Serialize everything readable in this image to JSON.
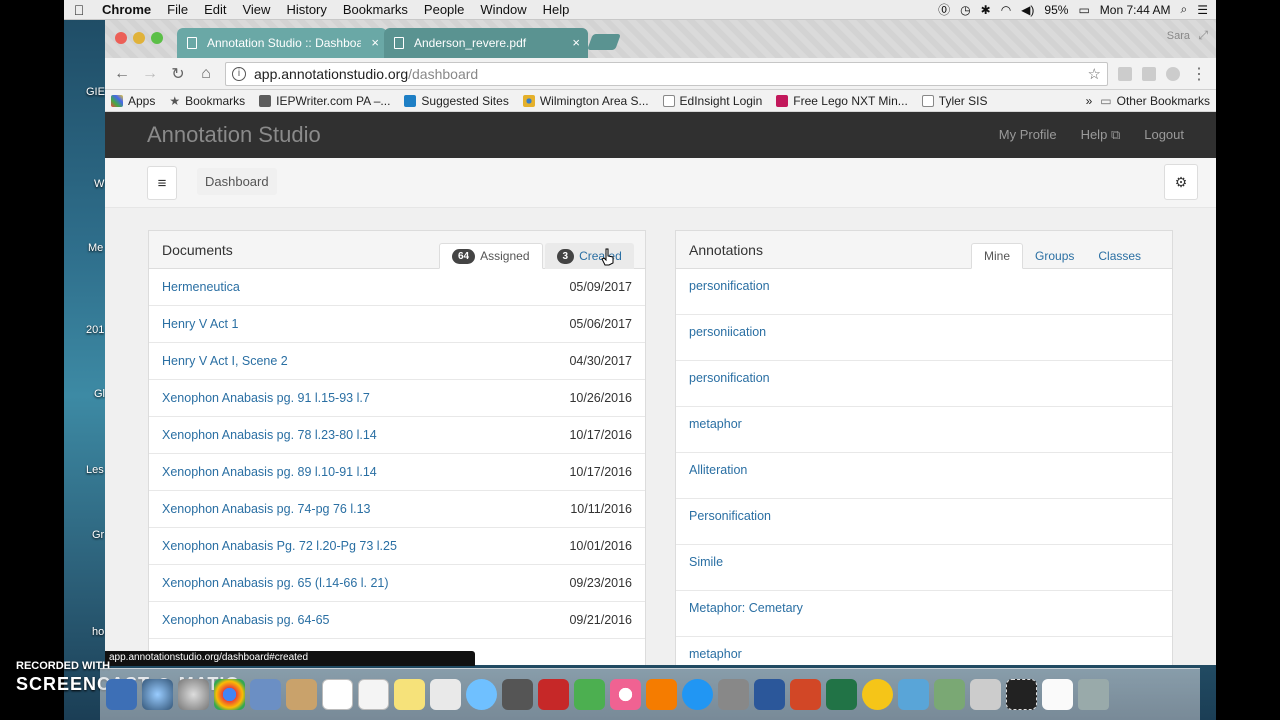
{
  "menubar": {
    "app": "Chrome",
    "items": [
      "File",
      "Edit",
      "View",
      "History",
      "Bookmarks",
      "People",
      "Window",
      "Help"
    ],
    "battery": "95%",
    "clock": "Mon 7:44 AM"
  },
  "desktop": {
    "labels": [
      "GIE",
      "W",
      "Me",
      "201",
      "Gl",
      "Les",
      "Gr",
      "ho"
    ]
  },
  "browser": {
    "tabs": [
      {
        "title": "Annotation Studio :: Dashboa"
      },
      {
        "title": "Anderson_revere.pdf"
      }
    ],
    "profile": "Sara",
    "url_host": "app.annotationstudio.org",
    "url_path": "/dashboard",
    "bookmarks": [
      {
        "label": "Apps",
        "icon": "apps-grid-icon"
      },
      {
        "label": "Bookmarks",
        "icon": "star-icon"
      },
      {
        "label": "IEPWriter.com PA –...",
        "icon": "iepwriter-icon"
      },
      {
        "label": "Suggested Sites",
        "icon": "bing-icon"
      },
      {
        "label": "Wilmington Area S...",
        "icon": "dots-icon"
      },
      {
        "label": "EdInsight Login",
        "icon": "page-icon"
      },
      {
        "label": "Free Lego NXT Min...",
        "icon": "lego-icon"
      },
      {
        "label": "Tyler SIS",
        "icon": "page-icon"
      }
    ],
    "more_bookmarks_glyph": "»",
    "other_bookmarks": "Other Bookmarks",
    "status_url": "app.annotationstudio.org/dashboard#created"
  },
  "app": {
    "brand": "Annotation Studio",
    "nav": {
      "profile": "My Profile",
      "help": "Help",
      "logout": "Logout"
    },
    "breadcrumb": "Dashboard"
  },
  "documents": {
    "title": "Documents",
    "tabs": [
      {
        "count": "64",
        "label": "Assigned"
      },
      {
        "count": "3",
        "label": "Created"
      }
    ],
    "rows": [
      {
        "title": "Hermeneutica",
        "date": "05/09/2017"
      },
      {
        "title": "Henry V Act 1",
        "date": "05/06/2017"
      },
      {
        "title": "Henry V Act I, Scene 2",
        "date": "04/30/2017"
      },
      {
        "title": "Xenophon Anabasis pg. 91 l.15-93 l.7",
        "date": "10/26/2016"
      },
      {
        "title": "Xenophon Anabasis pg. 78 l.23-80 l.14",
        "date": "10/17/2016"
      },
      {
        "title": "Xenophon Anabasis pg. 89 l.10-91 l.14",
        "date": "10/17/2016"
      },
      {
        "title": "Xenophon Anabasis pg. 74-pg 76 l.13",
        "date": "10/11/2016"
      },
      {
        "title": "Xenophon Anabasis Pg. 72 l.20-Pg 73 l.25",
        "date": "10/01/2016"
      },
      {
        "title": "Xenophon Anabasis pg. 65 (l.14-66 l. 21)",
        "date": "09/23/2016"
      },
      {
        "title": "Xenophon Anabasis pg. 64-65",
        "date": "09/21/2016"
      }
    ]
  },
  "annotations": {
    "title": "Annotations",
    "tabs": [
      "Mine",
      "Groups",
      "Classes"
    ],
    "rows": [
      "personification",
      "personiication",
      "personification",
      "metaphor",
      "Alliteration",
      "Personification",
      "Simile",
      "Metaphor:  Cemetary",
      "metaphor"
    ]
  },
  "watermark": {
    "line1": "RECORDED WITH",
    "line2": "SCREENCAST ◎ MATIC"
  },
  "colors": {
    "link": "#2a6fa3",
    "nav_bg": "#303030",
    "tab_teal": "#6aa8a6"
  }
}
